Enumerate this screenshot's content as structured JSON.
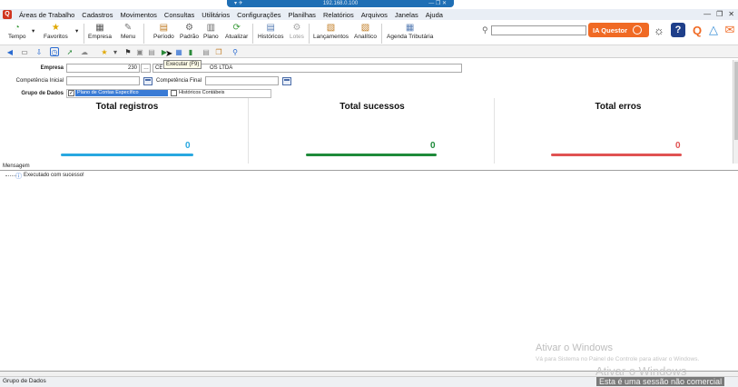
{
  "rdp": {
    "host": "192.168.0.100"
  },
  "menu": [
    "Áreas de Trabalho",
    "Cadastros",
    "Movimentos",
    "Consultas",
    "Utilitários",
    "Configurações",
    "Planilhas",
    "Relatórios",
    "Arquivos",
    "Janelas",
    "Ajuda"
  ],
  "toolbar": {
    "tempo": "Tempo",
    "favoritos": "Favoritos",
    "empresa": "Empresa",
    "menu": "Menu",
    "periodo": "Período",
    "padrao": "Padrão",
    "plano": "Plano",
    "atualizar": "Atualizar",
    "historicos": "Históricos",
    "lotes": "Lotes",
    "lancamentos": "Lançamentos",
    "analitico": "Analítico",
    "agenda": "Agenda Tributária",
    "ia_label": "IA Questor"
  },
  "tooltip": "Executar (F9)",
  "form": {
    "empresa_label": "Empresa",
    "empresa_code": "230",
    "empresa_name_left": "CE",
    "empresa_name_right": "OS LTDA",
    "competencia_inicial_label": "Competência Inicial",
    "competencia_final_label": "Competência Final",
    "grupo_label": "Grupo de Dados",
    "opt1": "Plano de Contas Específico",
    "opt2": "Históricos Contábeis",
    "opt1_checked": "✓"
  },
  "stats": [
    {
      "title": "Total registros",
      "value": "0",
      "color": "#29a8e0"
    },
    {
      "title": "Total sucessos",
      "value": "0",
      "color": "#1e8a3a"
    },
    {
      "title": "Total erros",
      "value": "0",
      "color": "#e05252"
    }
  ],
  "messages": {
    "label": "Mensagem",
    "line1": "Executado com sucesso!"
  },
  "status": {
    "text": "Grupo de Dados"
  },
  "watermark": {
    "title": "Ativar o Windows",
    "sub": "Vá para Sistema no Painel de Controle para ativar o Windows.",
    "title2": "Ativar o Windows",
    "banner": "Esta é uma sessão não comercial"
  }
}
